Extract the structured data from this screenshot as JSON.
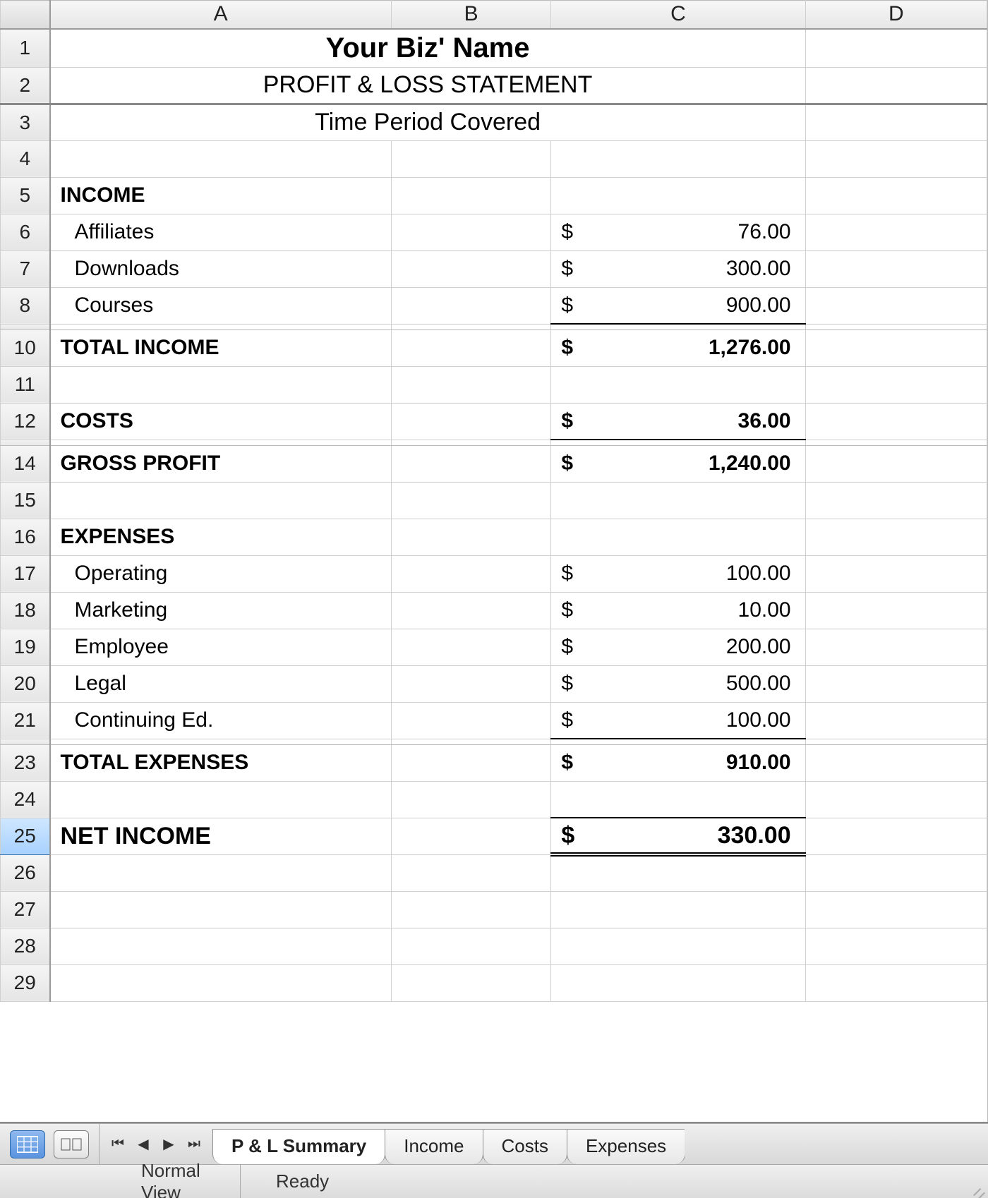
{
  "columns": [
    "A",
    "B",
    "C",
    "D"
  ],
  "title": "Your Biz' Name",
  "subtitle": "PROFIT & LOSS STATEMENT",
  "period": "Time Period Covered",
  "labels": {
    "income": "INCOME",
    "total_income": "TOTAL INCOME",
    "costs": "COSTS",
    "gross_profit": "GROSS PROFIT",
    "expenses": "EXPENSES",
    "total_expenses": "TOTAL EXPENSES",
    "net_income": "NET INCOME",
    "currency": "$"
  },
  "income_items": [
    {
      "label": "Affiliates",
      "amount": "76.00"
    },
    {
      "label": "Downloads",
      "amount": "300.00"
    },
    {
      "label": "Courses",
      "amount": "900.00"
    }
  ],
  "total_income": "1,276.00",
  "costs_amount": "36.00",
  "gross_profit": "1,240.00",
  "expense_items": [
    {
      "label": "Operating",
      "amount": "100.00"
    },
    {
      "label": "Marketing",
      "amount": "10.00"
    },
    {
      "label": "Employee",
      "amount": "200.00"
    },
    {
      "label": "Legal",
      "amount": "500.00"
    },
    {
      "label": "Continuing Ed.",
      "amount": "100.00"
    }
  ],
  "total_expenses": "910.00",
  "net_income": "330.00",
  "rownums": {
    "r1": "1",
    "r2": "2",
    "r3": "3",
    "r4": "4",
    "r5": "5",
    "r6": "6",
    "r7": "7",
    "r8": "8",
    "r10": "10",
    "r11": "11",
    "r12": "12",
    "r14": "14",
    "r15": "15",
    "r16": "16",
    "r17": "17",
    "r18": "18",
    "r19": "19",
    "r20": "20",
    "r21": "21",
    "r23": "23",
    "r24": "24",
    "r25": "25",
    "r26": "26",
    "r27": "27",
    "r28": "28",
    "r29": "29"
  },
  "tabs": [
    {
      "label": "P & L Summary",
      "active": true
    },
    {
      "label": "Income"
    },
    {
      "label": "Costs"
    },
    {
      "label": "Expenses"
    }
  ],
  "status": {
    "view": "Normal View",
    "ready": "Ready"
  }
}
